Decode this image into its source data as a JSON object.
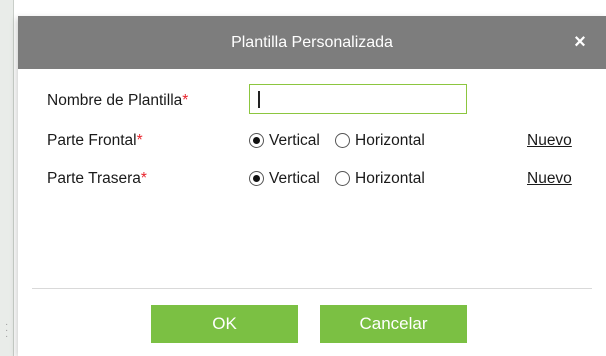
{
  "dialog": {
    "title": "Plantilla Personalizada",
    "close_symbol": "×",
    "close_icon": "close-icon"
  },
  "form": {
    "template_name": {
      "label": "Nombre de Plantilla",
      "required_mark": "*",
      "value": ""
    },
    "front": {
      "label": "Parte Frontal",
      "required_mark": "*",
      "options": [
        "Vertical",
        "Horizontal"
      ],
      "selected": "Vertical",
      "link": "Nuevo"
    },
    "back": {
      "label": "Parte Trasera",
      "required_mark": "*",
      "options": [
        "Vertical",
        "Horizontal"
      ],
      "selected": "Vertical",
      "link": "Nuevo"
    }
  },
  "buttons": {
    "ok": "OK",
    "cancel": "Cancelar"
  },
  "colors": {
    "titlebar": "#7d7d7d",
    "button": "#7bc043",
    "input_border": "#8cc63f",
    "required": "#e8232c"
  }
}
